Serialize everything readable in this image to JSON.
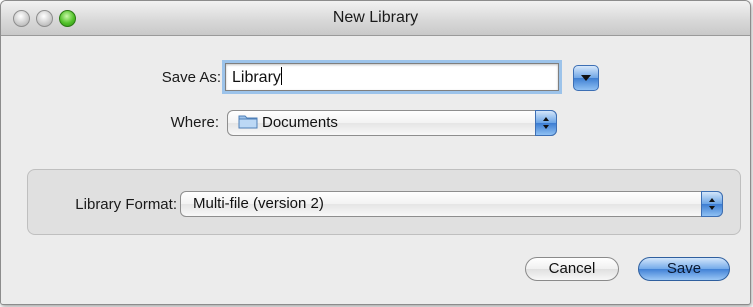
{
  "window": {
    "title": "New Library"
  },
  "form": {
    "save_as_label": "Save As:",
    "save_as_value": "Library",
    "where_label": "Where:",
    "where_value": "Documents",
    "where_icon": "folder-icon",
    "format_label": "Library Format:",
    "format_value": "Multi-file (version 2)"
  },
  "buttons": {
    "cancel_label": "Cancel",
    "save_label": "Save"
  },
  "colors": {
    "accent": "#4282d6",
    "focus_ring": "#9cc3ea",
    "window_bg": "#ececec"
  }
}
